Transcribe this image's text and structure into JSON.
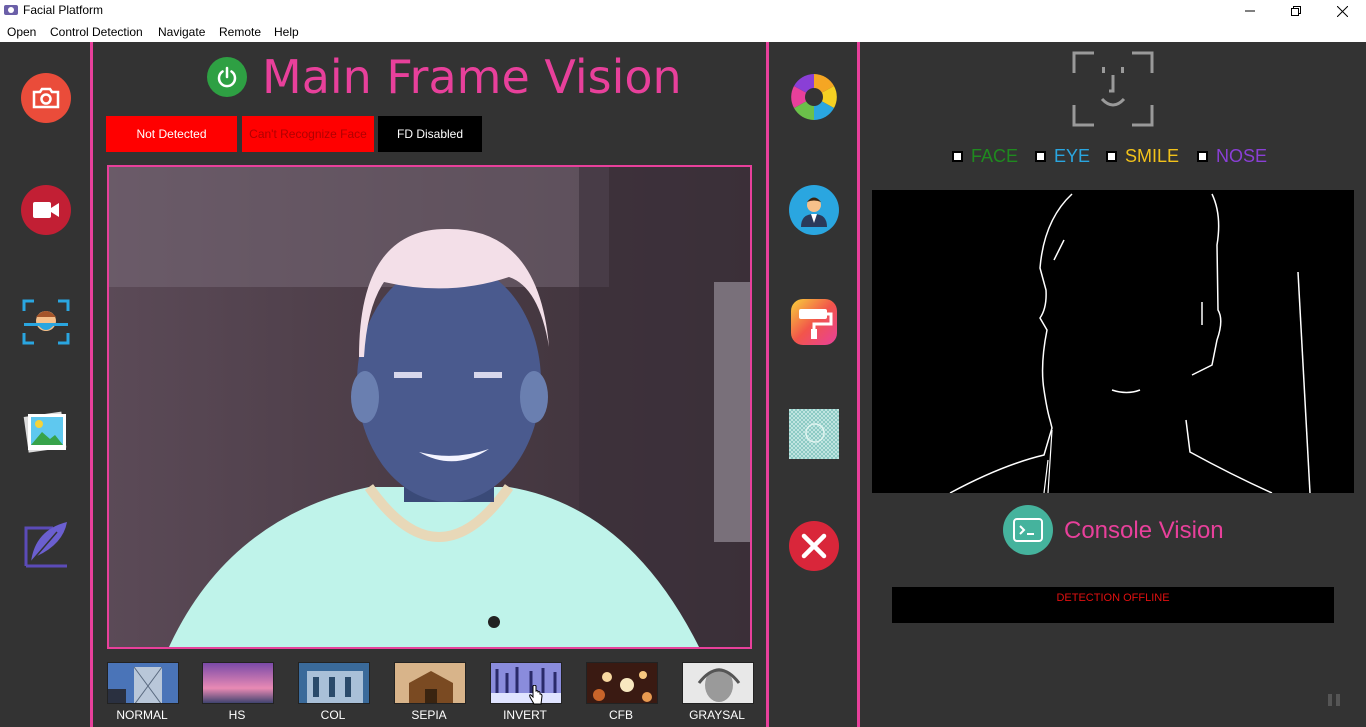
{
  "window": {
    "title": "Facial Platform"
  },
  "menu": [
    "Open",
    "Control Detection",
    "Navigate",
    "Remote",
    "Help"
  ],
  "main": {
    "title": "Main Frame Vision",
    "status": [
      {
        "label": "Not Detected",
        "bg": "#ff0000",
        "fg": "#ffffff"
      },
      {
        "label": "Can't Recognize Face",
        "bg": "#ff0000",
        "fg": "#b00000"
      },
      {
        "label": "FD Disabled",
        "bg": "#000000",
        "fg": "#ffffff"
      }
    ]
  },
  "filters": [
    "NORMAL",
    "HS",
    "COL",
    "SEPIA",
    "INVERT",
    "CFB",
    "GRAYSAL"
  ],
  "detection": {
    "options": [
      {
        "label": "FACE",
        "color": "#1f8a1f"
      },
      {
        "label": "EYE",
        "color": "#2aa6e0"
      },
      {
        "label": "SMILE",
        "color": "#f2c21a"
      },
      {
        "label": "NOSE",
        "color": "#8a3fd6"
      }
    ]
  },
  "console": {
    "title": "Console Vision",
    "status": "DETECTION OFFLINE"
  },
  "left_toolbar": [
    "camera-icon",
    "video-icon",
    "face-scan-icon",
    "gallery-icon",
    "feather-icon"
  ],
  "middle_toolbar": [
    "color-wheel-icon",
    "user-profile-icon",
    "paint-roller-icon",
    "pattern-icon",
    "close-icon"
  ],
  "colors": {
    "accent": "#e8409b",
    "panel": "#333333"
  }
}
